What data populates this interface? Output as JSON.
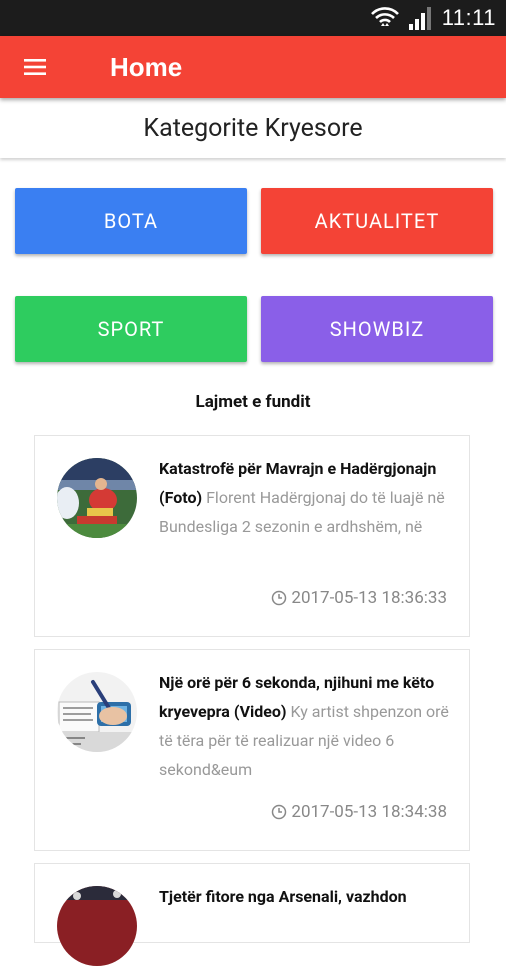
{
  "status_bar": {
    "time": "11:11"
  },
  "app_bar": {
    "title": "Home"
  },
  "section": {
    "title": "Kategorite Kryesore"
  },
  "categories": [
    {
      "label": "BOTA",
      "color": "#3a7ff2"
    },
    {
      "label": "AKTUALITET",
      "color": "#f44336"
    },
    {
      "label": "SPORT",
      "color": "#2ecc5f"
    },
    {
      "label": "SHOWBIZ",
      "color": "#8a5fe8"
    }
  ],
  "latest": {
    "heading": "Lajmet e fundit",
    "items": [
      {
        "title": "Katastrofë për Mavrajn e Hadërgjonajn (Foto)",
        "excerpt": "Florent Hadërgjonaj do të luajë në Bundesliga 2 sezonin e ardhshëm, në",
        "date": "2017-05-13 18:36:33",
        "thumb_icon": "football-player-photo"
      },
      {
        "title": "Një orë për 6 sekonda, njihuni me këto kryevepra (Video)",
        "excerpt": "Ky artist shpenzon orë të tëra për të realizuar një video 6 sekond&eum",
        "date": "2017-05-13 18:34:38",
        "thumb_icon": "drawing-hand-photo"
      },
      {
        "title": "Tjetër fitore nga Arsenali, vazhdon",
        "excerpt": "",
        "date": "",
        "thumb_icon": "stadium-photo"
      }
    ]
  },
  "colors": {
    "app_bar": "#f44336",
    "status_bar": "#1c1c1c"
  }
}
